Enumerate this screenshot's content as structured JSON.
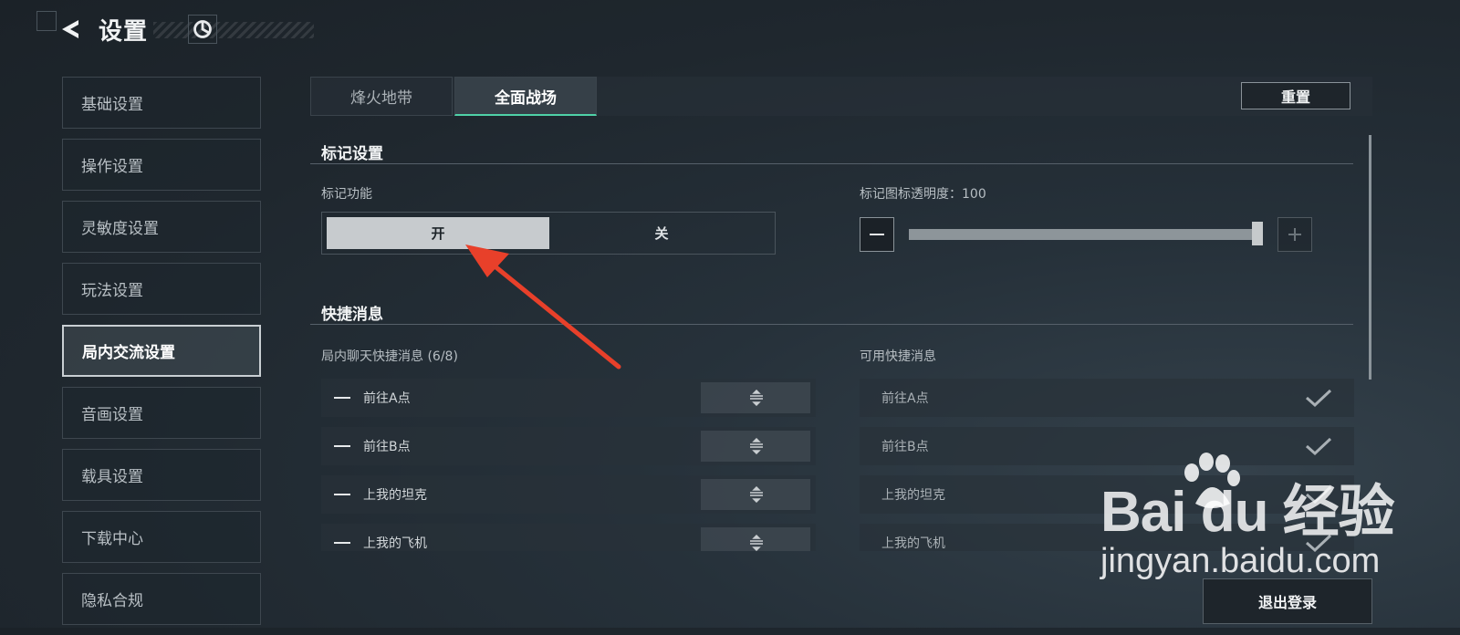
{
  "header": {
    "title": "设置"
  },
  "sidebar": {
    "items": [
      {
        "label": "基础设置"
      },
      {
        "label": "操作设置"
      },
      {
        "label": "灵敏度设置"
      },
      {
        "label": "玩法设置"
      },
      {
        "label": "局内交流设置"
      },
      {
        "label": "音画设置"
      },
      {
        "label": "载具设置"
      },
      {
        "label": "下载中心"
      },
      {
        "label": "隐私合规"
      }
    ],
    "active_index": 4
  },
  "tabs": [
    {
      "label": "烽火地带"
    },
    {
      "label": "全面战场"
    }
  ],
  "active_tab": 1,
  "reset_label": "重置",
  "mark_section": {
    "title": "标记设置",
    "function_label": "标记功能",
    "toggle_on": "开",
    "toggle_off": "关",
    "toggle_selected": "开",
    "opacity_label": "标记图标透明度：100",
    "opacity_value": 100
  },
  "quick_section": {
    "title": "快捷消息",
    "chat_label": "局内聊天快捷消息 (6/8)",
    "available_label": "可用快捷消息",
    "chat_messages": [
      {
        "text": "前往A点"
      },
      {
        "text": "前往B点"
      },
      {
        "text": "上我的坦克"
      },
      {
        "text": "上我的飞机"
      }
    ],
    "available_messages": [
      {
        "text": "前往A点"
      },
      {
        "text": "前往B点"
      },
      {
        "text": "上我的坦克"
      },
      {
        "text": "上我的飞机"
      }
    ]
  },
  "logout_label": "退出登录",
  "watermark": {
    "logo_text": "Bai du 经验",
    "url": "jingyan.baidu.com"
  },
  "colors": {
    "accent": "#4fd1a7",
    "arrow": "#e8402a"
  },
  "icons": {
    "back": "back-arrow-icon",
    "logo": "game-logo-icon",
    "drag": "drag-handle-icon",
    "check": "check-icon",
    "minus": "minus-icon",
    "plus": "plus-icon"
  }
}
